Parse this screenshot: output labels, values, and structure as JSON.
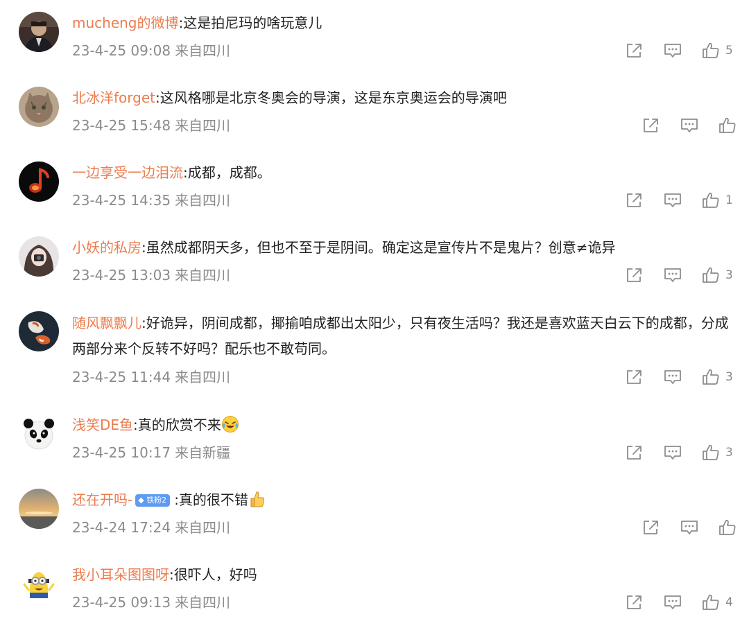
{
  "comments": [
    {
      "user": "mucheng的微博",
      "text": ":这是拍尼玛的啥玩意儿",
      "time": "23-4-25 09:08",
      "location": "来自四川",
      "likes": "5"
    },
    {
      "user": "北冰洋forget",
      "text": ":这风格哪是北京冬奥会的导演，这是东京奥运会的导演吧",
      "time": "23-4-25 15:48",
      "location": "来自四川",
      "likes": ""
    },
    {
      "user": "一边享受一边泪流",
      "text": ":成都，成都。",
      "time": "23-4-25 14:35",
      "location": "来自四川",
      "likes": "1"
    },
    {
      "user": "小妖的私房",
      "text": ":虽然成都阴天多，但也不至于是阴间。确定这是宣传片不是鬼片？创意≠诡异",
      "time": "23-4-25 13:03",
      "location": "来自四川",
      "likes": "3"
    },
    {
      "user": "随风飘飘儿",
      "text": ":好诡异，阴间成都，揶揄咱成都出太阳少，只有夜生活吗？我还是喜欢蓝天白云下的成都，分成两部分来个反转不好吗？配乐也不敢苟同。",
      "time": "23-4-25 11:44",
      "location": "来自四川",
      "likes": "3"
    },
    {
      "user": "浅笑DE鱼",
      "text": ":真的欣赏不来",
      "time": "23-4-25 10:17",
      "location": "来自新疆",
      "likes": "3",
      "emoji": "laughing-crying-emoji"
    },
    {
      "user": "还在开吗-",
      "badge": "铁粉2",
      "text": ":真的很不错",
      "time": "23-4-24 17:24",
      "location": "来自四川",
      "likes": "",
      "emoji": "thumbs-up-emoji"
    },
    {
      "user": "我小耳朵图图呀",
      "text": ":很吓人，好吗",
      "time": "23-4-25 09:13",
      "location": "来自四川",
      "likes": "4"
    }
  ],
  "colors": {
    "username": "#ec7c4f",
    "text": "#222222",
    "meta": "#8a8a8a",
    "badge": "#5d9cf2"
  },
  "icons": {
    "share": "share-icon",
    "reply": "comment-icon",
    "like": "thumbs-up-icon"
  }
}
